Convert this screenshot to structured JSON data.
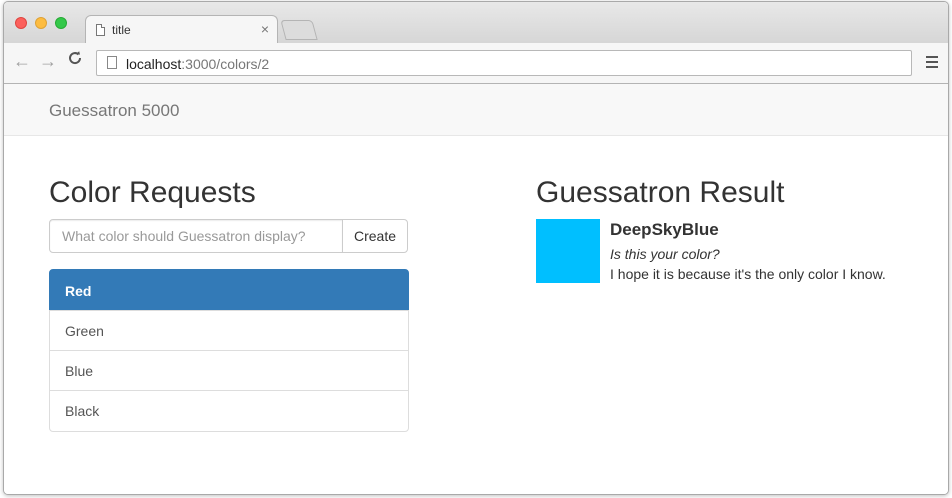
{
  "browser": {
    "tab_title": "title",
    "tab_close": "×",
    "url_host": "localhost",
    "url_path": ":3000/colors/2",
    "back_glyph": "←",
    "forward_glyph": "→",
    "reload_glyph": "C"
  },
  "navbar": {
    "brand": "Guessatron 5000"
  },
  "requests": {
    "heading": "Color Requests",
    "input_placeholder": "What color should Guessatron display?",
    "create_label": "Create",
    "items": [
      {
        "label": "Red",
        "active": true
      },
      {
        "label": "Green",
        "active": false
      },
      {
        "label": "Blue",
        "active": false
      },
      {
        "label": "Black",
        "active": false
      }
    ]
  },
  "result": {
    "heading": "Guessatron Result",
    "color_name": "DeepSkyBlue",
    "color_hex": "#00bfff",
    "question": "Is this your color?",
    "answer": "I hope it is because it's the only color I know."
  },
  "colors": {
    "accent": "#337ab7"
  },
  "icons": [
    "document-icon",
    "back-arrow-icon",
    "forward-arrow-icon",
    "reload-icon",
    "hamburger-menu-icon",
    "close-icon"
  ]
}
